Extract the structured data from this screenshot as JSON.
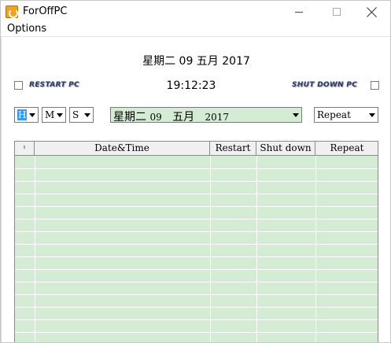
{
  "window": {
    "title": "ForOffPC",
    "minimize_symbol": "",
    "maximize_symbol": "",
    "close_symbol": ""
  },
  "menu": {
    "options_label": "Options"
  },
  "header": {
    "date_text": "星期二 09 五月 2017",
    "time_text": "19:12:23",
    "restart_label": "RESTART PC",
    "shutdown_label": "SHUT DOWN PC",
    "restart_checked": false,
    "shutdown_checked": false
  },
  "controls": {
    "hour_value": "H",
    "minute_value": "M",
    "second_value": "S",
    "date_weekday": "星期二",
    "date_day": "09",
    "date_month": "五月",
    "date_year": "2017",
    "repeat_value": "Repeat"
  },
  "table": {
    "columns": [
      "¹",
      "Date&Time",
      "Restart",
      "Shut down",
      "Repeat"
    ],
    "rows": []
  },
  "colors": {
    "grid_background": "#d3ecd3",
    "selection": "#3399ff",
    "emboss_text": "#2f3a63"
  },
  "icons": {
    "app": "clock-power-icon",
    "dropdown": "chevron-down-icon"
  }
}
